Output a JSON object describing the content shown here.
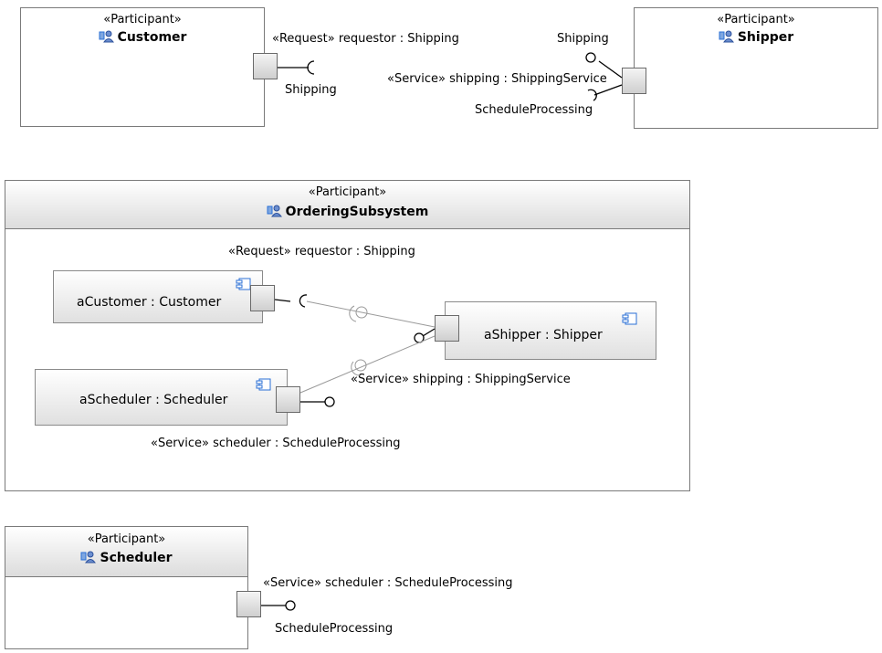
{
  "participant_stereotype": "«Participant»",
  "customer": {
    "name": "Customer",
    "port_label": "«Request» requestor : Shipping",
    "interface_label": "Shipping"
  },
  "shipper": {
    "name": "Shipper",
    "port_label": "«Service» shipping : ShippingService",
    "provided_interface": "Shipping",
    "required_interface": "ScheduleProcessing"
  },
  "ordering_subsystem": {
    "name": "OrderingSubsystem",
    "request_label": "«Request» requestor : Shipping",
    "parts": {
      "customer": "aCustomer : Customer",
      "shipper": "aShipper : Shipper",
      "scheduler": "aScheduler : Scheduler"
    },
    "service_shipping_label": "«Service» shipping : ShippingService",
    "service_scheduler_label": "«Service» scheduler : ScheduleProcessing"
  },
  "scheduler": {
    "name": "Scheduler",
    "port_label": "«Service» scheduler : ScheduleProcessing",
    "interface_label": "ScheduleProcessing"
  },
  "colors": {
    "border": "#7a7a7a",
    "header_gradient_end": "#dcdcdc",
    "icon_blue": "#2a6fd6"
  }
}
